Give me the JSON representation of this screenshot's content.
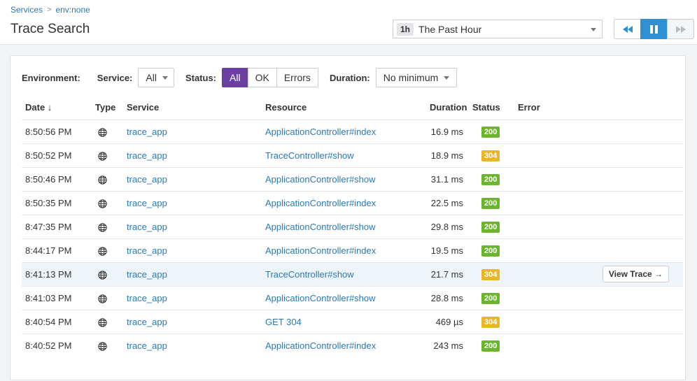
{
  "breadcrumb": {
    "parent": "Services",
    "separator": ">",
    "current": "env:none"
  },
  "title": "Trace Search",
  "timeframe": {
    "badge": "1h",
    "label": "The Past Hour"
  },
  "filters": {
    "environment_label": "Environment:",
    "service_label": "Service:",
    "service_value": "All",
    "status_label": "Status:",
    "status_options": [
      "All",
      "OK",
      "Errors"
    ],
    "status_selected": "All",
    "duration_label": "Duration:",
    "duration_value": "No minimum"
  },
  "columns": [
    "Date ↓",
    "Type",
    "Service",
    "Resource",
    "Duration",
    "Status",
    "Error"
  ],
  "rows": [
    {
      "date": "8:50:56 PM",
      "service": "trace_app",
      "resource": "ApplicationController#index",
      "duration": "16.9 ms",
      "status": "200"
    },
    {
      "date": "8:50:52 PM",
      "service": "trace_app",
      "resource": "TraceController#show",
      "duration": "18.9 ms",
      "status": "304"
    },
    {
      "date": "8:50:46 PM",
      "service": "trace_app",
      "resource": "ApplicationController#show",
      "duration": "31.1 ms",
      "status": "200"
    },
    {
      "date": "8:50:35 PM",
      "service": "trace_app",
      "resource": "ApplicationController#index",
      "duration": "22.5 ms",
      "status": "200"
    },
    {
      "date": "8:47:35 PM",
      "service": "trace_app",
      "resource": "ApplicationController#show",
      "duration": "29.8 ms",
      "status": "200"
    },
    {
      "date": "8:44:17 PM",
      "service": "trace_app",
      "resource": "ApplicationController#index",
      "duration": "19.5 ms",
      "status": "200"
    },
    {
      "date": "8:41:13 PM",
      "service": "trace_app",
      "resource": "TraceController#show",
      "duration": "21.7 ms",
      "status": "304"
    },
    {
      "date": "8:41:03 PM",
      "service": "trace_app",
      "resource": "ApplicationController#show",
      "duration": "28.8 ms",
      "status": "200"
    },
    {
      "date": "8:40:54 PM",
      "service": "trace_app",
      "resource": "GET 304",
      "duration": "469 µs",
      "status": "304"
    },
    {
      "date": "8:40:52 PM",
      "service": "trace_app",
      "resource": "ApplicationController#index",
      "duration": "243 ms",
      "status": "200"
    }
  ],
  "hovered_row": 6,
  "view_trace_label": "View Trace →",
  "icons": {
    "type": "globe-icon",
    "rewind": "rewind-icon",
    "pause": "pause-icon",
    "forward": "fast-forward-icon"
  },
  "colors": {
    "status_200": "#6ab42e",
    "status_304": "#e8b629",
    "accent": "#6e3fa3",
    "link": "#2a7ab0",
    "live": "#2f8fd1"
  }
}
